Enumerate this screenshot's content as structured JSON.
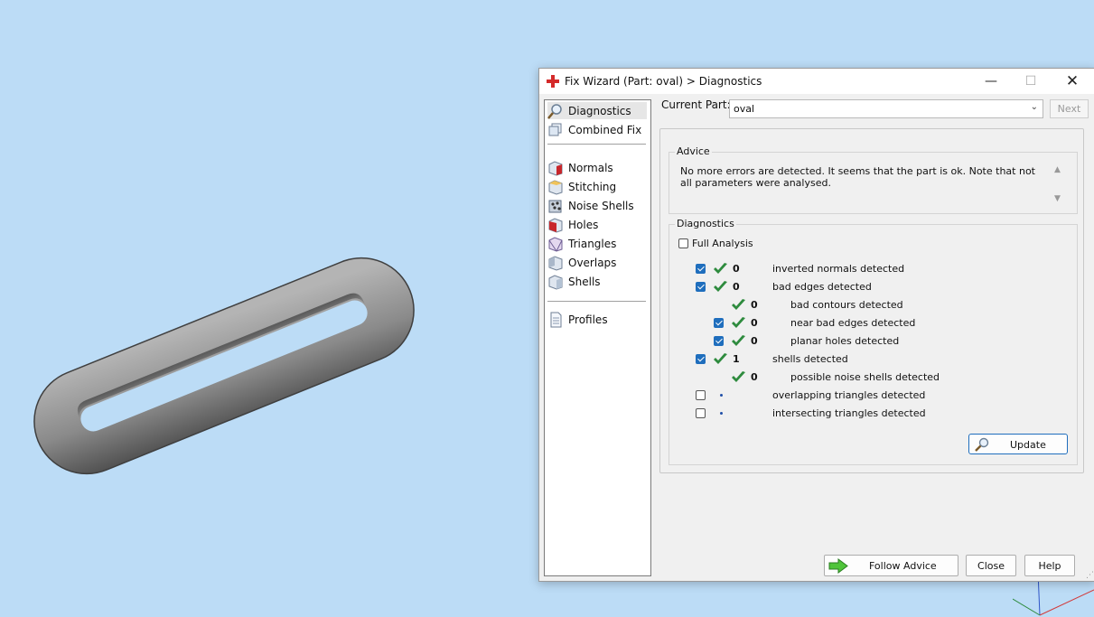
{
  "window": {
    "title": "Fix Wizard (Part: oval) > Diagnostics",
    "controls": {
      "minimize": "—",
      "maximize": "☐",
      "close": "✕"
    }
  },
  "nav": {
    "items": [
      {
        "label": "Diagnostics",
        "icon": "magnifier-icon",
        "active": true
      },
      {
        "label": "Combined Fix",
        "icon": "cube-stack-icon"
      },
      {
        "label": "Normals",
        "icon": "normals-cube-icon"
      },
      {
        "label": "Stitching",
        "icon": "stitching-cube-icon"
      },
      {
        "label": "Noise Shells",
        "icon": "noise-shells-icon"
      },
      {
        "label": "Holes",
        "icon": "holes-cube-icon"
      },
      {
        "label": "Triangles",
        "icon": "triangles-cube-icon"
      },
      {
        "label": "Overlaps",
        "icon": "overlaps-cube-icon"
      },
      {
        "label": "Shells",
        "icon": "shells-cube-icon"
      },
      {
        "label": "Profiles",
        "icon": "profiles-icon"
      }
    ]
  },
  "current_part": {
    "label": "Current Part:",
    "value": "oval",
    "next_label": "Next"
  },
  "advice": {
    "title": "Advice",
    "text": "No more errors are detected. It seems that the part is ok. Note that not all parameters were analysed."
  },
  "diagnostics": {
    "title": "Diagnostics",
    "full_analysis_label": "Full Analysis",
    "full_analysis_checked": false,
    "rows": [
      {
        "checked": true,
        "status": "ok",
        "count": "0",
        "label": "inverted normals detected",
        "indent": 0
      },
      {
        "checked": true,
        "status": "ok",
        "count": "0",
        "label": "bad edges detected",
        "indent": 0
      },
      {
        "checked": null,
        "status": "ok",
        "count": "0",
        "label": "bad contours detected",
        "indent": 1
      },
      {
        "checked": true,
        "status": "ok",
        "count": "0",
        "label": "near bad edges detected",
        "indent": 1
      },
      {
        "checked": true,
        "status": "ok",
        "count": "0",
        "label": "planar holes detected",
        "indent": 1
      },
      {
        "checked": true,
        "status": "ok",
        "count": "1",
        "label": "shells detected",
        "indent": 0
      },
      {
        "checked": null,
        "status": "ok",
        "count": "0",
        "label": "possible noise shells detected",
        "indent": 1
      },
      {
        "checked": false,
        "status": "pending",
        "count": "",
        "label": "overlapping triangles detected",
        "indent": 0
      },
      {
        "checked": false,
        "status": "pending",
        "count": "",
        "label": "intersecting triangles detected",
        "indent": 0
      }
    ],
    "update_label": "Update"
  },
  "buttons": {
    "follow_advice": "Follow Advice",
    "close": "Close",
    "help": "Help"
  },
  "colors": {
    "viewport_bg": "#bcdcf6",
    "check_green": "#2e8b3e",
    "accent_blue": "#1f6ebd"
  }
}
